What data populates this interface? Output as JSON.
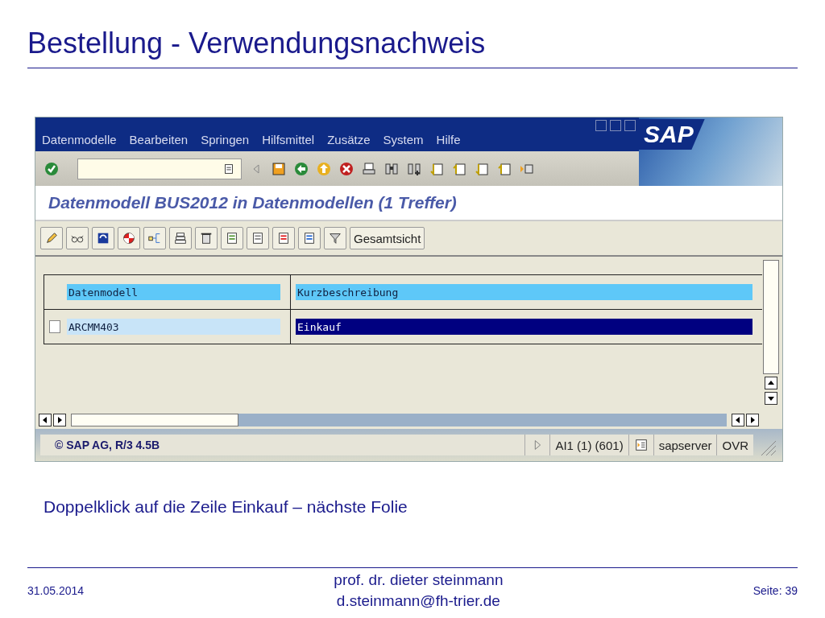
{
  "slide": {
    "title": "Bestellung - Verwendungsnachweis",
    "caption": "Doppelklick auf die Zeile Einkauf – nächste Folie"
  },
  "sap_window": {
    "menu": [
      "Datenmodelle",
      "Bearbeiten",
      "Springen",
      "Hilfsmittel",
      "Zusätze",
      "System",
      "Hilfe"
    ],
    "logo": "SAP",
    "screen_title": "Datenmodell BUS2012 in Datenmodellen (1 Treffer)",
    "overview_button": "Gesamtsicht",
    "table": {
      "columns": [
        "Datenmodell",
        "Kurzbeschreibung"
      ],
      "rows": [
        {
          "datenmodell": "ARCMM403",
          "kurzbeschreibung": "Einkauf",
          "checked": false,
          "selected": true
        }
      ]
    },
    "status_bar": {
      "copyright": "© SAP AG, R/3 4.5B",
      "session": "AI1 (1) (601)",
      "server": "sapserver",
      "mode": "OVR"
    }
  },
  "footer": {
    "date": "31.05.2014",
    "author": "prof. dr. dieter steinmann",
    "email": "d.steinmann@fh-trier.de",
    "page": "Seite: 39"
  }
}
